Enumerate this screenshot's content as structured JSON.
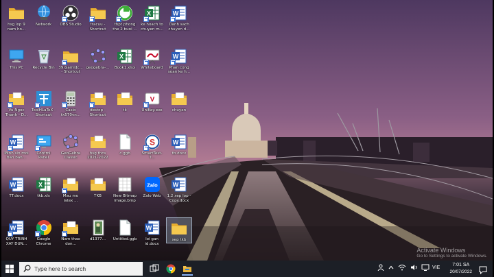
{
  "desktop": {
    "icons": [
      {
        "label": "hsg lop 9 nam ho...",
        "icon": "folder-icon",
        "shortcut": false,
        "selected": false
      },
      {
        "label": "Network",
        "icon": "network-icon",
        "shortcut": false,
        "selected": false
      },
      {
        "label": "OBS Studio",
        "icon": "obs-icon",
        "shortcut": true,
        "selected": false
      },
      {
        "label": "tracuu - Shortcut",
        "icon": "folder-icon",
        "shortcut": true,
        "selected": false
      },
      {
        "label": "thpt phong the 2 buoi ...",
        "icon": "green-app-icon",
        "shortcut": true,
        "selected": false
      },
      {
        "label": "ke hoach to chuyen m...",
        "icon": "excel-icon",
        "shortcut": true,
        "selected": false
      },
      {
        "label": "Danh sach chuyen d...",
        "icon": "word-icon",
        "shortcut": true,
        "selected": false
      },
      {
        "label": "This PC",
        "icon": "this-pc-icon",
        "shortcut": false,
        "selected": false
      },
      {
        "label": "Recycle Bin",
        "icon": "recycle-bin-icon",
        "shortcut": false,
        "selected": false
      },
      {
        "label": "39.Gamidc... - Shortcut",
        "icon": "folder-icon",
        "shortcut": true,
        "selected": false
      },
      {
        "label": "geogebra-...",
        "icon": "geogebra-icon",
        "shortcut": false,
        "selected": false
      },
      {
        "label": "Book1.xlsx",
        "icon": "excel-icon",
        "shortcut": false,
        "selected": false
      },
      {
        "label": "Whiteboard",
        "icon": "whiteboard-icon",
        "shortcut": true,
        "selected": false
      },
      {
        "label": "Phan cong soan ke h...",
        "icon": "word-icon",
        "shortcut": true,
        "selected": false
      },
      {
        "label": "Vu Ngoc Thanh - D...",
        "icon": "folder-doc-icon",
        "shortcut": true,
        "selected": false
      },
      {
        "label": "ToolHLaTeX - Shortcut",
        "icon": "toolhlatex-icon",
        "shortcut": true,
        "selected": false
      },
      {
        "label": "Casio fx570vn...",
        "icon": "calculator-icon",
        "shortcut": true,
        "selected": false
      },
      {
        "label": "destop - Shortcut",
        "icon": "folder-doc-icon",
        "shortcut": true,
        "selected": false
      },
      {
        "label": "tk",
        "icon": "folder-doc-icon",
        "shortcut": false,
        "selected": false
      },
      {
        "label": "UniKey.exe",
        "icon": "unikey-icon",
        "shortcut": true,
        "selected": false
      },
      {
        "label": "chuyen",
        "icon": "folder-doc-icon",
        "shortcut": false,
        "selected": false
      },
      {
        "label": "Minh sin moi ban ban...",
        "icon": "word-icon",
        "shortcut": true,
        "selected": false
      },
      {
        "label": "Control Panel",
        "icon": "control-panel-icon",
        "shortcut": true,
        "selected": false
      },
      {
        "label": "GeoGebra Classic",
        "icon": "geogebra-icon",
        "shortcut": false,
        "selected": false
      },
      {
        "label": "hsg thcs 2021-2022",
        "icon": "folder-doc-icon",
        "shortcut": false,
        "selected": false
      },
      {
        "label": "c.ggb",
        "icon": "blank-file-icon",
        "shortcut": false,
        "selected": false
      },
      {
        "label": "SmartTest-T...",
        "icon": "smarttest-icon",
        "shortcut": true,
        "selected": false
      },
      {
        "label": "tb.docx",
        "icon": "word-icon",
        "shortcut": false,
        "selected": false
      },
      {
        "label": "TT.docx",
        "icon": "word-icon",
        "shortcut": false,
        "selected": false
      },
      {
        "label": "tkb.xls",
        "icon": "excel-icon",
        "shortcut": false,
        "selected": false
      },
      {
        "label": "Mau mo latex ...",
        "icon": "folder-doc-icon",
        "shortcut": true,
        "selected": false
      },
      {
        "label": "TKB",
        "icon": "folder-doc-icon",
        "shortcut": false,
        "selected": false
      },
      {
        "label": "New Bitmap image.bmp",
        "icon": "bitmap-icon",
        "shortcut": false,
        "selected": false
      },
      {
        "label": "Zalo Web",
        "icon": "zalo-icon",
        "shortcut": false,
        "selected": false
      },
      {
        "label": "1.2 xep lop - Copy.docx",
        "icon": "word-icon",
        "shortcut": false,
        "selected": false
      },
      {
        "label": "QUY TRINH XAY DUN...",
        "icon": "word-icon",
        "shortcut": true,
        "selected": false
      },
      {
        "label": "Google Chrome",
        "icon": "chrome-icon",
        "shortcut": true,
        "selected": false
      },
      {
        "label": "Nam thao don...",
        "icon": "folder-doc-icon",
        "shortcut": true,
        "selected": false
      },
      {
        "label": "d1377...",
        "icon": "image-icon",
        "shortcut": false,
        "selected": false
      },
      {
        "label": "Untitled.ggb",
        "icon": "blank-file-icon",
        "shortcut": false,
        "selected": false
      },
      {
        "label": "loi gan id.docx",
        "icon": "word-icon",
        "shortcut": false,
        "selected": false
      },
      {
        "label": "xep tkb",
        "icon": "folder-icon",
        "shortcut": false,
        "selected": true
      }
    ]
  },
  "watermark": {
    "line1": "Activate Windows",
    "line2": "Go to Settings to activate Windows."
  },
  "taskbar": {
    "search_placeholder": "Type here to search",
    "apps": [
      {
        "name": "task-view-icon",
        "active": false
      },
      {
        "name": "chrome-icon",
        "active": false
      },
      {
        "name": "geogebra-icon",
        "active": true
      },
      {
        "name": "file-explorer-icon",
        "active": true
      }
    ],
    "tray": {
      "language": "VIE",
      "time": "7:01 SA",
      "date": "20/07/2022"
    }
  },
  "colors": {
    "sky_top": "#5a3f66",
    "sky_mid": "#9a6a8c",
    "taskbar": "#1c1f26",
    "folder": "#f3c14c",
    "word": "#2b5eb8",
    "excel": "#1f7a44"
  }
}
